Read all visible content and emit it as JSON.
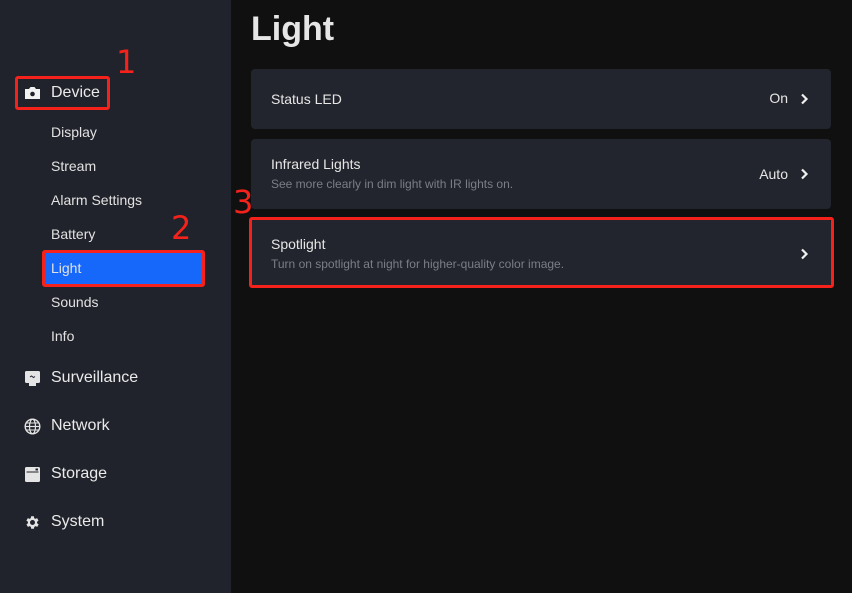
{
  "sidebar": {
    "sections": [
      {
        "label": "Device",
        "icon": "camera-icon"
      },
      {
        "label": "Surveillance",
        "icon": "monitor-icon"
      },
      {
        "label": "Network",
        "icon": "globe-icon"
      },
      {
        "label": "Storage",
        "icon": "storage-icon"
      },
      {
        "label": "System",
        "icon": "gear-icon"
      }
    ],
    "device_items": [
      {
        "label": "Display"
      },
      {
        "label": "Stream"
      },
      {
        "label": "Alarm Settings"
      },
      {
        "label": "Battery"
      },
      {
        "label": "Light",
        "active": true
      },
      {
        "label": "Sounds"
      },
      {
        "label": "Info"
      }
    ]
  },
  "main": {
    "title": "Light",
    "cards": [
      {
        "title": "Status LED",
        "description": "",
        "value": "On"
      },
      {
        "title": "Infrared Lights",
        "description": "See more clearly in dim light with IR lights on.",
        "value": "Auto"
      },
      {
        "title": "Spotlight",
        "description": "Turn on spotlight at night for higher-quality color image.",
        "value": ""
      }
    ]
  },
  "annotations": [
    "1",
    "2",
    "3"
  ],
  "colors": {
    "accent": "#1668fa",
    "annotation": "#f5221b",
    "sidebar_bg": "#20232b",
    "card_bg": "#22252d",
    "main_bg": "#101011"
  }
}
